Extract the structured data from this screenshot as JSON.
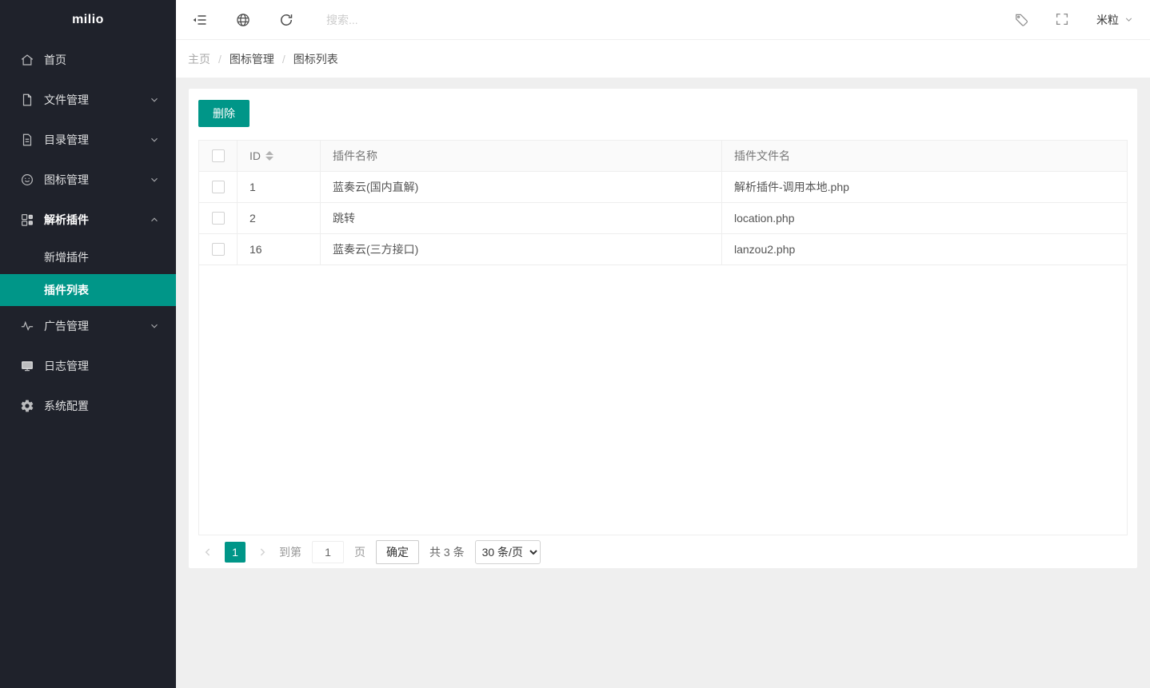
{
  "colors": {
    "accent": "#009688",
    "sidebar_bg": "#1f222b"
  },
  "sidebar": {
    "logo": "milio",
    "items": [
      {
        "label": "首页",
        "icon": "home-icon"
      },
      {
        "label": "文件管理",
        "icon": "file-icon",
        "chevron": "down"
      },
      {
        "label": "目录管理",
        "icon": "file-text-icon",
        "chevron": "down"
      },
      {
        "label": "图标管理",
        "icon": "smiley-icon",
        "chevron": "down"
      },
      {
        "label": "解析插件",
        "icon": "components-icon",
        "chevron": "up",
        "expanded": true
      },
      {
        "label": "广告管理",
        "icon": "pulse-icon",
        "chevron": "down"
      },
      {
        "label": "日志管理",
        "icon": "monitor-icon"
      },
      {
        "label": "系统配置",
        "icon": "gear-icon"
      }
    ],
    "submenu": [
      {
        "label": "新增插件",
        "active": false
      },
      {
        "label": "插件列表",
        "active": true
      }
    ]
  },
  "topbar": {
    "icons": [
      "collapse-icon",
      "globe-icon",
      "refresh-icon",
      "tag-icon",
      "fullscreen-icon"
    ],
    "search_placeholder": "搜索...",
    "user": "米粒"
  },
  "breadcrumb": {
    "items": [
      "主页",
      "图标管理",
      "图标列表"
    ],
    "separator": "/"
  },
  "toolbar": {
    "delete_label": "删除"
  },
  "table": {
    "columns": {
      "id": "ID",
      "name": "插件名称",
      "file": "插件文件名"
    },
    "rows": [
      {
        "id": "1",
        "name": "蓝奏云(国内直解)",
        "file": "解析插件-调用本地.php"
      },
      {
        "id": "2",
        "name": "跳转",
        "file": "location.php"
      },
      {
        "id": "16",
        "name": "蓝奏云(三方接口)",
        "file": "lanzou2.php"
      }
    ]
  },
  "pagination": {
    "current_page": "1",
    "goto_label": "到第",
    "goto_value": "1",
    "page_unit_label": "页",
    "confirm_label": "确定",
    "total_label": "共 3 条",
    "per_page_selected": "30 条/页"
  }
}
